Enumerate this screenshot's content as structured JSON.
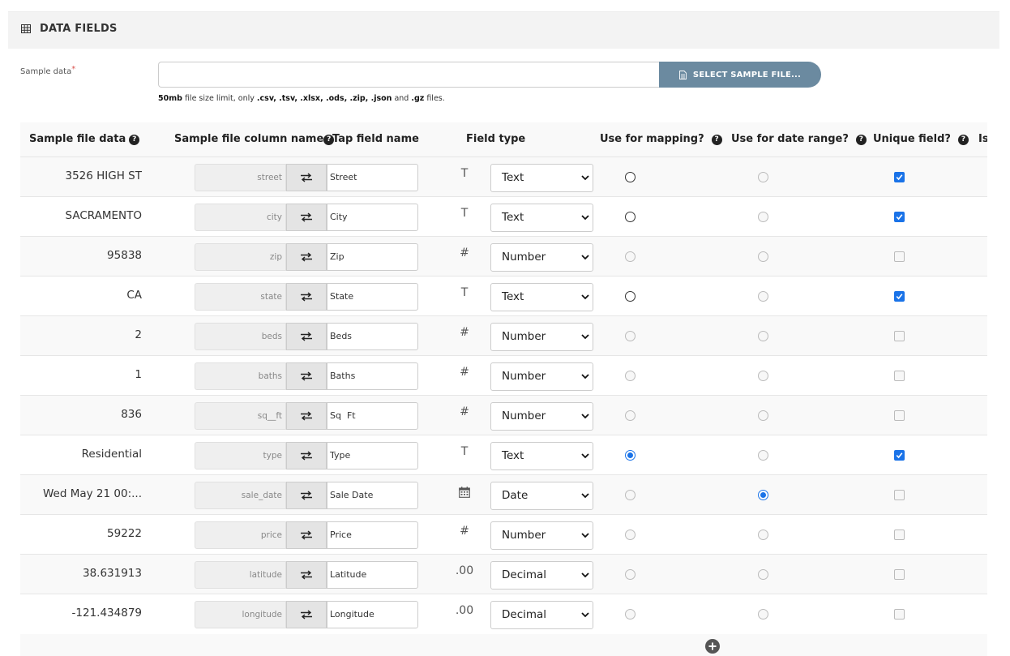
{
  "header": {
    "title": "DATA FIELDS",
    "icon": "table-grid-icon"
  },
  "sample": {
    "label": "Sample data",
    "required_mark": "*",
    "input_value": "",
    "button_label": "SELECT SAMPLE FILE...",
    "button_icon": "file-icon",
    "hint_size": "50mb",
    "hint_mid": " file size limit, only ",
    "hint_exts": ".csv, .tsv, .xlsx, .ods, .zip, .json",
    "hint_and": " and ",
    "hint_gz": ".gz",
    "hint_end": " files."
  },
  "table": {
    "headers": {
      "sample": "Sample file data",
      "colname": "Sample file column name",
      "tapname": "Tap field name",
      "fieldtype": "Field type",
      "mapping": "Use for mapping?",
      "daterange": "Use for date range?",
      "unique": "Unique field?",
      "is": "Is"
    },
    "help_glyph": "?",
    "rows": [
      {
        "sample": "3526 HIGH ST",
        "column": "street",
        "tap": "Street",
        "type_icon": "T",
        "type": "Text",
        "mapping": "enabled",
        "date": "disabled",
        "unique": true
      },
      {
        "sample": "SACRAMENTO",
        "column": "city",
        "tap": "City",
        "type_icon": "T",
        "type": "Text",
        "mapping": "enabled",
        "date": "disabled",
        "unique": true
      },
      {
        "sample": "95838",
        "column": "zip",
        "tap": "Zip",
        "type_icon": "#",
        "type": "Number",
        "mapping": "disabled",
        "date": "disabled",
        "unique": false
      },
      {
        "sample": "CA",
        "column": "state",
        "tap": "State",
        "type_icon": "T",
        "type": "Text",
        "mapping": "enabled",
        "date": "disabled",
        "unique": true
      },
      {
        "sample": "2",
        "column": "beds",
        "tap": "Beds",
        "type_icon": "#",
        "type": "Number",
        "mapping": "disabled",
        "date": "disabled",
        "unique": false
      },
      {
        "sample": "1",
        "column": "baths",
        "tap": "Baths",
        "type_icon": "#",
        "type": "Number",
        "mapping": "disabled",
        "date": "disabled",
        "unique": false
      },
      {
        "sample": "836",
        "column": "sq__ft",
        "tap": "Sq  Ft",
        "type_icon": "#",
        "type": "Number",
        "mapping": "disabled",
        "date": "disabled",
        "unique": false
      },
      {
        "sample": "Residential",
        "column": "type",
        "tap": "Type",
        "type_icon": "T",
        "type": "Text",
        "mapping": "checked",
        "date": "disabled",
        "unique": true
      },
      {
        "sample": "Wed May 21 00:...",
        "column": "sale_date",
        "tap": "Sale Date",
        "type_icon": "calendar",
        "type": "Date",
        "mapping": "disabled",
        "date": "checked",
        "unique": false
      },
      {
        "sample": "59222",
        "column": "price",
        "tap": "Price",
        "type_icon": "#",
        "type": "Number",
        "mapping": "disabled",
        "date": "disabled",
        "unique": false
      },
      {
        "sample": "38.631913",
        "column": "latitude",
        "tap": "Latitude",
        "type_icon": ".00",
        "type": "Decimal",
        "mapping": "disabled",
        "date": "disabled",
        "unique": false
      },
      {
        "sample": "-121.434879",
        "column": "longitude",
        "tap": "Longitude",
        "type_icon": ".00",
        "type": "Decimal",
        "mapping": "disabled",
        "date": "disabled",
        "unique": false
      }
    ]
  },
  "colors": {
    "accent": "#1a73e8",
    "button": "#6b8aa0",
    "required": "#d9534f"
  }
}
